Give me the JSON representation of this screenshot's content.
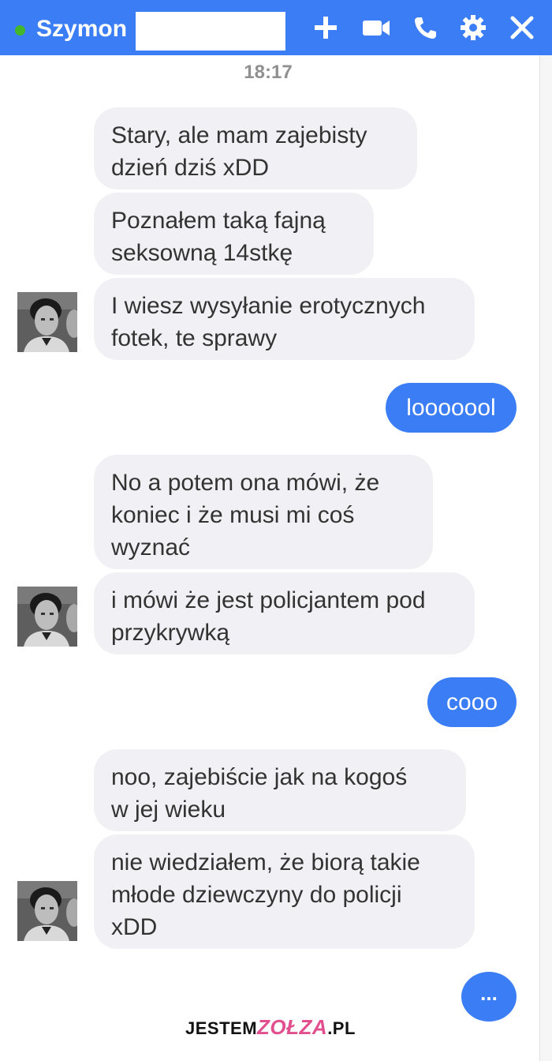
{
  "header": {
    "contact_name": "Szymon",
    "icons": [
      "plus-icon",
      "video-icon",
      "phone-icon",
      "gear-icon",
      "close-icon"
    ],
    "color": "#3b7df5",
    "online_color": "#42b72a"
  },
  "chat": {
    "timestamp": "18:17",
    "messages": [
      {
        "side": "in",
        "text": "Stary, ale mam zajebisty\ndzień dziś xDD"
      },
      {
        "side": "in",
        "text": "Poznałem taką fajną\nseksowną 14stkę"
      },
      {
        "side": "in",
        "text": "I wiesz wysyłanie erotycznych\nfotek, te sprawy"
      },
      {
        "side": "out",
        "text": "looooool"
      },
      {
        "side": "in",
        "text": "No a potem ona mówi, że\nkoniec i że musi mi coś\nwyznać"
      },
      {
        "side": "in",
        "text": "i mówi że jest policjantem pod\nprzykrywką"
      },
      {
        "side": "out",
        "text": "cooo"
      },
      {
        "side": "in",
        "text": "noo, zajebiście jak na kogoś\nw jej wieku"
      },
      {
        "side": "in",
        "text": "nie wiedziałem, że biorą takie\nmłode dziewczyny do policji\nxDD"
      }
    ],
    "typing_indicator": "...",
    "incoming_bubble_color": "#f1f0f4",
    "outgoing_bubble_color": "#3b7df5"
  },
  "watermark": {
    "prefix": "JESTEM",
    "accent": "ZOŁZA",
    "suffix": ".PL"
  }
}
